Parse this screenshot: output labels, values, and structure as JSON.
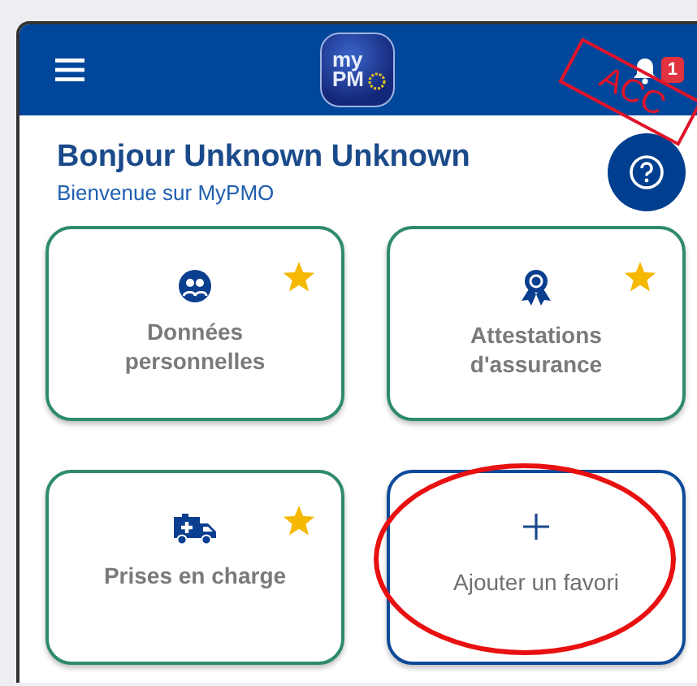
{
  "header": {
    "logo": {
      "line1": "my",
      "line2": "PM"
    },
    "notifications": {
      "count": "1"
    },
    "environment_stamp": "ACC"
  },
  "greeting": {
    "title": "Bonjour Unknown Unknown",
    "subtitle": "Bienvenue sur MyPMO"
  },
  "tiles": [
    {
      "kind": "shortcut",
      "label": "Données personnelles",
      "favorite": true,
      "highlighted": false
    },
    {
      "kind": "shortcut",
      "label": "Attestations d'assurance",
      "favorite": true,
      "highlighted": false
    },
    {
      "kind": "shortcut",
      "label": "Prises en charge",
      "favorite": true,
      "highlighted": false
    },
    {
      "kind": "add",
      "label": "Ajouter un favori",
      "favorite": false,
      "highlighted": true
    }
  ]
}
